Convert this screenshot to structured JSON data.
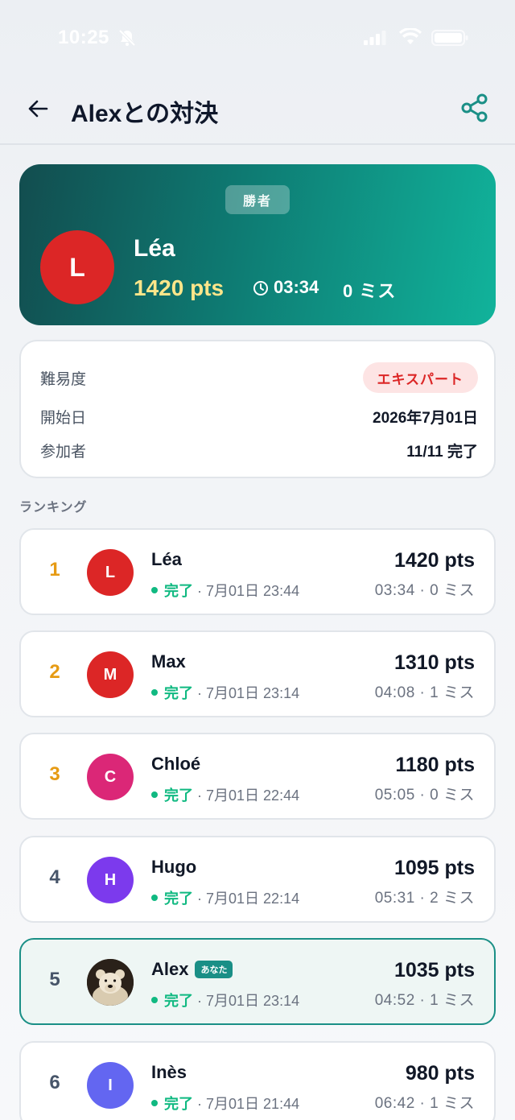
{
  "status_bar": {
    "time": "10:25",
    "icons": [
      "bell-off-icon",
      "signal-icon",
      "wifi-icon",
      "battery-icon"
    ]
  },
  "header": {
    "title": "Alexとの対決",
    "back_icon": "arrow-left-icon",
    "share_icon": "share-icon"
  },
  "winner": {
    "badge": "勝者",
    "initial": "L",
    "name": "Léa",
    "points": "1420 pts",
    "time": "03:34",
    "misses": "0 ミス",
    "avatar_color": "#dc2626",
    "points_color": "#fde68a"
  },
  "info": {
    "difficulty_label": "難易度",
    "difficulty_value": "エキスパート",
    "start_label": "開始日",
    "start_value": "2026年7月01日",
    "participants_label": "参加者",
    "participants_value": "11/11 完了"
  },
  "ranking": {
    "label": "ランキング",
    "status_done": "完了",
    "you_badge": "あなた",
    "rows": [
      {
        "rank": "1",
        "initial": "L",
        "name": "Léa",
        "color": "#dc2626",
        "datetime": "· 7月01日 23:44",
        "points": "1420 pts",
        "detail": "03:34 · 0 ミス"
      },
      {
        "rank": "2",
        "initial": "M",
        "name": "Max",
        "color": "#dc2626",
        "datetime": "· 7月01日 23:14",
        "points": "1310 pts",
        "detail": "04:08 · 1 ミス"
      },
      {
        "rank": "3",
        "initial": "C",
        "name": "Chloé",
        "color": "#db2777",
        "datetime": "· 7月01日 22:44",
        "points": "1180 pts",
        "detail": "05:05 · 0 ミス"
      },
      {
        "rank": "4",
        "initial": "H",
        "name": "Hugo",
        "color": "#7c3aed",
        "datetime": "· 7月01日 22:14",
        "points": "1095 pts",
        "detail": "05:31 · 2 ミス"
      },
      {
        "rank": "5",
        "initial": "",
        "name": "Alex",
        "color": "#3b3026",
        "datetime": "· 7月01日 23:14",
        "points": "1035 pts",
        "detail": "04:52 · 1 ミス"
      },
      {
        "rank": "6",
        "initial": "I",
        "name": "Inès",
        "color": "#6366f1",
        "datetime": "· 7月01日 21:44",
        "points": "980 pts",
        "detail": "06:42 · 1 ミス"
      }
    ]
  },
  "colors": {
    "accent": "#1a8f86",
    "gold_rank": "#e69b14",
    "done_green": "#10b981"
  }
}
